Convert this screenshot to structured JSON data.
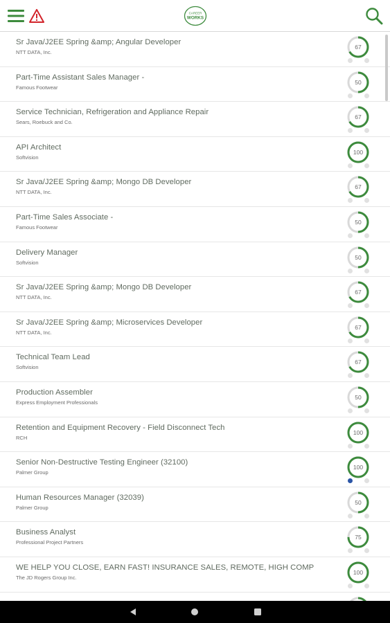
{
  "header": {
    "logo_small": "CAREER",
    "logo_big": "WORKS",
    "icons": {
      "menu": "hamburger-menu-icon",
      "alert": "warning-icon",
      "search": "search-icon"
    }
  },
  "colors": {
    "accent": "#3d8b3d",
    "ring_track": "#d9d9d9",
    "active_dot": "#2b55a6",
    "title": "#5f6a5f"
  },
  "jobs": [
    {
      "title": "Sr Java/J2EE Spring &amp; Angular Developer",
      "company": "NTT DATA, Inc.",
      "score": "67",
      "match": 0.67,
      "dot_active": false
    },
    {
      "title": "Part-Time Assistant Sales Manager -",
      "company": "Famous Footwear",
      "score": "50",
      "match": 0.5,
      "dot_active": false
    },
    {
      "title": "Service Technician, Refrigeration and Appliance Repair",
      "company": "Sears, Roebuck and Co.",
      "score": "67",
      "match": 0.67,
      "dot_active": false
    },
    {
      "title": "API Architect",
      "company": "Softvision",
      "score": "100",
      "match": 1.0,
      "dot_active": false
    },
    {
      "title": "Sr Java/J2EE Spring &amp; Mongo DB Developer",
      "company": "NTT DATA, Inc.",
      "score": "67",
      "match": 0.67,
      "dot_active": false
    },
    {
      "title": "Part-Time Sales Associate -",
      "company": "Famous Footwear",
      "score": "50",
      "match": 0.5,
      "dot_active": false
    },
    {
      "title": "Delivery Manager",
      "company": "Softvision",
      "score": "50",
      "match": 0.5,
      "dot_active": false
    },
    {
      "title": "Sr Java/J2EE Spring &amp; Mongo DB Developer",
      "company": "NTT DATA, Inc.",
      "score": "67",
      "match": 0.67,
      "dot_active": false
    },
    {
      "title": "Sr Java/J2EE Spring &amp; Microservices Developer",
      "company": "NTT DATA, Inc.",
      "score": "67",
      "match": 0.67,
      "dot_active": false
    },
    {
      "title": "Technical Team Lead",
      "company": "Softvision",
      "score": "67",
      "match": 0.67,
      "dot_active": false
    },
    {
      "title": "Production Assembler",
      "company": "Express Employment Professionals",
      "score": "50",
      "match": 0.5,
      "dot_active": false
    },
    {
      "title": "Retention and Equipment Recovery - Field Disconnect Tech",
      "company": "RCH",
      "score": "100",
      "match": 1.0,
      "dot_active": false
    },
    {
      "title": "Senior Non-Destructive Testing Engineer (32100)",
      "company": "Palmer Group",
      "score": "100",
      "match": 1.0,
      "dot_active": true
    },
    {
      "title": "Human Resources Manager (32039)",
      "company": "Palmer Group",
      "score": "50",
      "match": 0.5,
      "dot_active": false
    },
    {
      "title": "Business Analyst",
      "company": "Professional Project Partners",
      "score": "75",
      "match": 0.75,
      "dot_active": false
    },
    {
      "title": "WE HELP YOU CLOSE, EARN FAST! INSURANCE SALES, REMOTE, HIGH COMP",
      "company": "The JD Rogers Group Inc.",
      "score": "100",
      "match": 1.0,
      "dot_active": false
    },
    {
      "title": "",
      "company": "",
      "score": "",
      "match": 0.67,
      "dot_active": false
    }
  ],
  "navbar": {
    "icons": [
      "back-icon",
      "home-icon",
      "recents-icon"
    ]
  }
}
